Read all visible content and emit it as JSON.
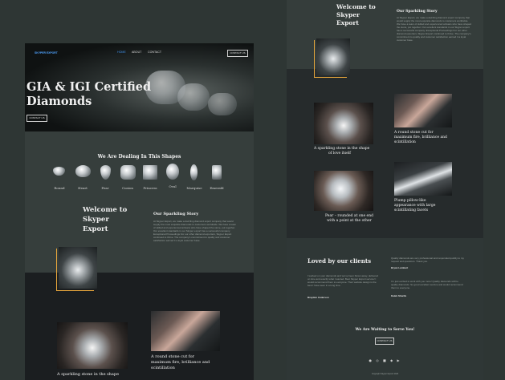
{
  "brand": {
    "logo": "SKYPER EXPORT"
  },
  "nav": {
    "items": [
      "HOME",
      "ABOUT",
      "CONTACT"
    ],
    "cta": "CONTACT US",
    "active_color": "#3f8ee6"
  },
  "hero": {
    "title_line1": "GIA & IGI Certified",
    "title_line2": "Diamonds",
    "button": "CONTACT US"
  },
  "shapes": {
    "heading": "We Are Dealing In This Shapes",
    "items": [
      "Round",
      "Heart",
      "Pear",
      "Cusion",
      "Princess",
      "Oval",
      "Marquise",
      "Emerald"
    ]
  },
  "welcome": {
    "line1": "Welcome to",
    "line2": "Skyper",
    "line3": "Export"
  },
  "story": {
    "title": "Our Sparkling Story",
    "body": "At Skyper Export, we make a dazzling diamond export company that would supply the most exquisite diamonds to customers worldwide. We have a team of skilled and experienced artisans who have shaped the stone, put together. Our excellent standards in our Skyper export has a successful company. Exceptional Proceedings For our other diamond exporters, Skyper Export continued to thrive. The company’s commitment to quality and customer satisfaction earned it a loyal customer base."
  },
  "accent_color": "#e7a63c",
  "gallery": [
    {
      "caption_line1": "A sparkling stone in the shape",
      "caption_line2": "of love itself"
    },
    {
      "caption_line1": "A round stone cut for",
      "caption_line2": "maximum fire, brilliance and",
      "caption_line3": "scintillation"
    },
    {
      "caption_line1": "Pear – rounded at one end",
      "caption_line2": "with a point at the other"
    },
    {
      "caption_line1": "Plump pillow-like",
      "caption_line2": "appearance with large",
      "caption_line3": "scintillating facets"
    }
  ],
  "clients": {
    "title": "Loved by our clients",
    "quote1": "I worked on your diamonds and we’ve been blown away, delivered on time and exactly what I wanted. Best Skyper Export service! I would recommend them to everyone. Their website design is the best I have seen in a long time.",
    "name1": "Brayden Anderson",
    "quote2": "Quality diamonds are very professional and responded quickly to my request and questions. Thank you.",
    "name2": "Bryan Lambert",
    "quote3": "I’m just excited to work with you more! Quality diamonds will be quality diamonds. So good excellent service and would recommend them to everyone.",
    "name3": "Kaleb Sharife"
  },
  "footer": {
    "heading": "We Are Waiting to Serve You!",
    "button": "CONTACT US",
    "copyright": "Copyright Skyper Export 2023"
  }
}
